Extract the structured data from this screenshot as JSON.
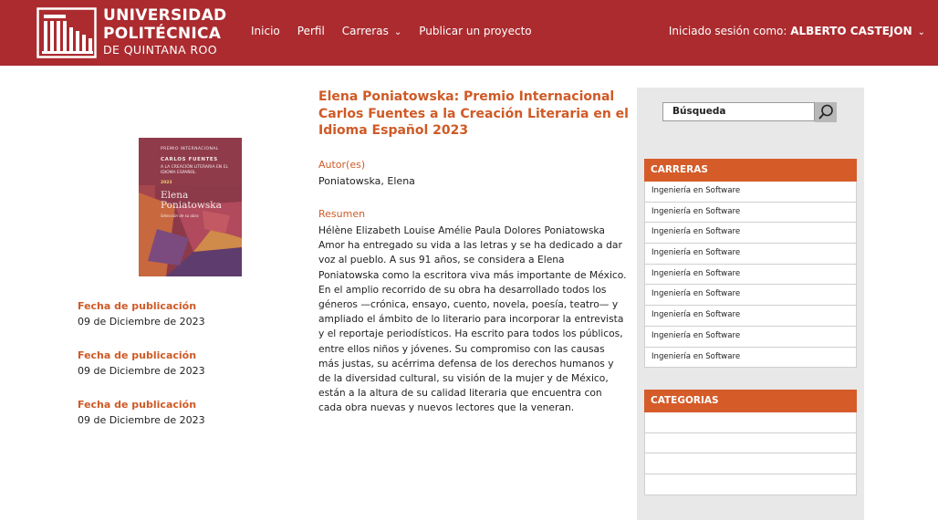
{
  "header": {
    "logo_line1": "UNIVERSIDAD",
    "logo_line2": "POLITÉCNICA",
    "logo_line3": "DE QUINTANA ROO",
    "nav": [
      "Inicio",
      "Perfil",
      "Carreras",
      "Publicar un proyecto"
    ],
    "session_label": "Iniciado sesión como:",
    "session_user": "ALBERTO CASTEJON",
    "brand_color": "#ab2b2f"
  },
  "cover": {
    "line1": "PREMIO INTERNACIONAL",
    "line2": "CARLOS FUENTES",
    "line3": "A LA CREACIÓN LITERARIA EN EL IDIOMA ESPAÑOL",
    "year": "2023",
    "author": "Elena Poniatowska",
    "caption": "Selección de su obra"
  },
  "meta": [
    {
      "label": "Fecha de publicación",
      "value": "09 de Diciembre de 2023"
    },
    {
      "label": "Fecha de publicación",
      "value": "09 de Diciembre de 2023"
    },
    {
      "label": "Fecha de publicación",
      "value": "09 de Diciembre de 2023"
    }
  ],
  "article": {
    "title": "Elena Poniatowska: Premio Internacional Carlos Fuentes a la Creación Literaria en el Idioma Español 2023",
    "authors_label": "Autor(es)",
    "authors": "Poniatowska, Elena",
    "summary_label": "Resumen",
    "summary": "Hélène Elizabeth Louise Amélie Paula Dolores Poniatowska Amor ha entregado su vida a las letras y se ha dedicado a dar voz al pueblo. A sus 91 años, se considera a Elena Poniatowska como la escritora viva más importante de México. En el amplio recorrido de su obra ha desarrollado todos los géneros —crónica, ensayo, cuento, novela, poesía, teatro— y ampliado el ámbito de lo literario para incorporar la entrevista y el reportaje periodísticos. Ha escrito para todos los públicos, entre ellos niños y jóvenes. Su compromiso con las causas más justas, su acérrima defensa de los derechos humanos y de la diversidad cultural, su visión de la mujer y de México, están a la altura de su calidad literaria que encuentra con cada obra nuevas y nuevos lectores que la veneran.",
    "accent_color": "#cf5a26"
  },
  "sidebar": {
    "search_placeholder": "Búsqueda",
    "carreras_title": "CARRERAS",
    "carreras": [
      "Ingeniería en Software",
      "Ingeniería en Software",
      "Ingeniería en Software",
      "Ingeniería en Software",
      "Ingeniería en Software",
      "Ingeniería en Software",
      "Ingeniería en Software",
      "Ingeniería en Software",
      "Ingeniería en Software"
    ],
    "categorias_title": "CATEGORIAS",
    "categorias": [
      "",
      "",
      "",
      ""
    ],
    "panel_color": "#d55b29"
  }
}
